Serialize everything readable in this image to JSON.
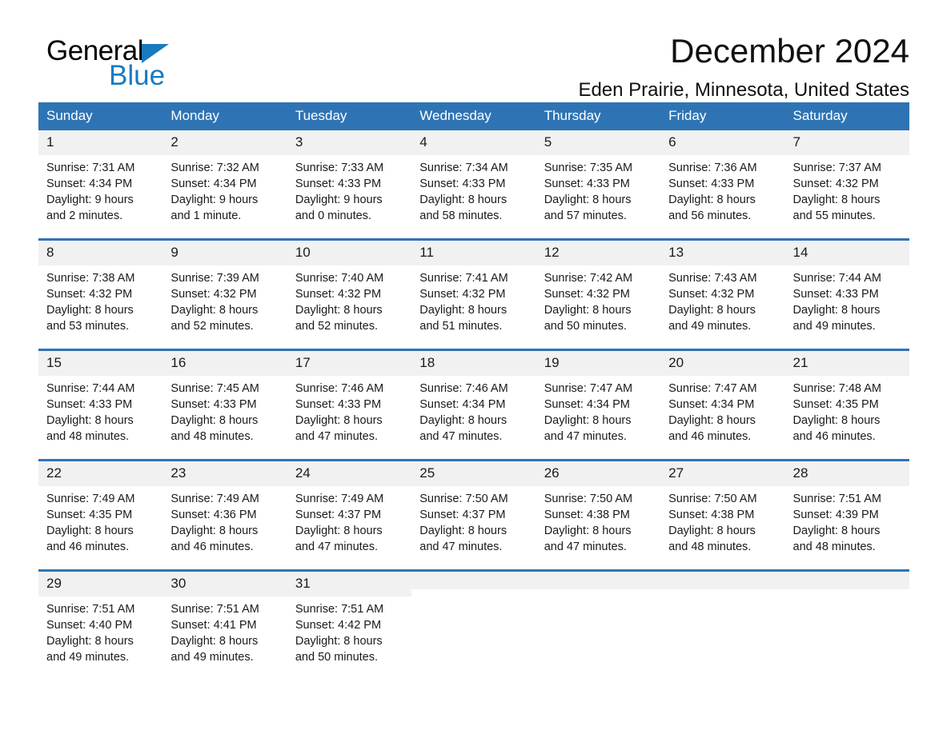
{
  "brand": {
    "name_part1": "General",
    "name_part2": "Blue",
    "accent_color": "#1a7ac0"
  },
  "header": {
    "title": "December 2024",
    "location": "Eden Prairie, Minnesota, United States",
    "header_bg_color": "#2e74b5",
    "daynum_bg_color": "#f1f1f1"
  },
  "weekday_headers": [
    "Sunday",
    "Monday",
    "Tuesday",
    "Wednesday",
    "Thursday",
    "Friday",
    "Saturday"
  ],
  "weeks": [
    [
      {
        "day": "1",
        "sunrise": "Sunrise: 7:31 AM",
        "sunset": "Sunset: 4:34 PM",
        "daylight_line1": "Daylight: 9 hours",
        "daylight_line2": "and 2 minutes."
      },
      {
        "day": "2",
        "sunrise": "Sunrise: 7:32 AM",
        "sunset": "Sunset: 4:34 PM",
        "daylight_line1": "Daylight: 9 hours",
        "daylight_line2": "and 1 minute."
      },
      {
        "day": "3",
        "sunrise": "Sunrise: 7:33 AM",
        "sunset": "Sunset: 4:33 PM",
        "daylight_line1": "Daylight: 9 hours",
        "daylight_line2": "and 0 minutes."
      },
      {
        "day": "4",
        "sunrise": "Sunrise: 7:34 AM",
        "sunset": "Sunset: 4:33 PM",
        "daylight_line1": "Daylight: 8 hours",
        "daylight_line2": "and 58 minutes."
      },
      {
        "day": "5",
        "sunrise": "Sunrise: 7:35 AM",
        "sunset": "Sunset: 4:33 PM",
        "daylight_line1": "Daylight: 8 hours",
        "daylight_line2": "and 57 minutes."
      },
      {
        "day": "6",
        "sunrise": "Sunrise: 7:36 AM",
        "sunset": "Sunset: 4:33 PM",
        "daylight_line1": "Daylight: 8 hours",
        "daylight_line2": "and 56 minutes."
      },
      {
        "day": "7",
        "sunrise": "Sunrise: 7:37 AM",
        "sunset": "Sunset: 4:32 PM",
        "daylight_line1": "Daylight: 8 hours",
        "daylight_line2": "and 55 minutes."
      }
    ],
    [
      {
        "day": "8",
        "sunrise": "Sunrise: 7:38 AM",
        "sunset": "Sunset: 4:32 PM",
        "daylight_line1": "Daylight: 8 hours",
        "daylight_line2": "and 53 minutes."
      },
      {
        "day": "9",
        "sunrise": "Sunrise: 7:39 AM",
        "sunset": "Sunset: 4:32 PM",
        "daylight_line1": "Daylight: 8 hours",
        "daylight_line2": "and 52 minutes."
      },
      {
        "day": "10",
        "sunrise": "Sunrise: 7:40 AM",
        "sunset": "Sunset: 4:32 PM",
        "daylight_line1": "Daylight: 8 hours",
        "daylight_line2": "and 52 minutes."
      },
      {
        "day": "11",
        "sunrise": "Sunrise: 7:41 AM",
        "sunset": "Sunset: 4:32 PM",
        "daylight_line1": "Daylight: 8 hours",
        "daylight_line2": "and 51 minutes."
      },
      {
        "day": "12",
        "sunrise": "Sunrise: 7:42 AM",
        "sunset": "Sunset: 4:32 PM",
        "daylight_line1": "Daylight: 8 hours",
        "daylight_line2": "and 50 minutes."
      },
      {
        "day": "13",
        "sunrise": "Sunrise: 7:43 AM",
        "sunset": "Sunset: 4:32 PM",
        "daylight_line1": "Daylight: 8 hours",
        "daylight_line2": "and 49 minutes."
      },
      {
        "day": "14",
        "sunrise": "Sunrise: 7:44 AM",
        "sunset": "Sunset: 4:33 PM",
        "daylight_line1": "Daylight: 8 hours",
        "daylight_line2": "and 49 minutes."
      }
    ],
    [
      {
        "day": "15",
        "sunrise": "Sunrise: 7:44 AM",
        "sunset": "Sunset: 4:33 PM",
        "daylight_line1": "Daylight: 8 hours",
        "daylight_line2": "and 48 minutes."
      },
      {
        "day": "16",
        "sunrise": "Sunrise: 7:45 AM",
        "sunset": "Sunset: 4:33 PM",
        "daylight_line1": "Daylight: 8 hours",
        "daylight_line2": "and 48 minutes."
      },
      {
        "day": "17",
        "sunrise": "Sunrise: 7:46 AM",
        "sunset": "Sunset: 4:33 PM",
        "daylight_line1": "Daylight: 8 hours",
        "daylight_line2": "and 47 minutes."
      },
      {
        "day": "18",
        "sunrise": "Sunrise: 7:46 AM",
        "sunset": "Sunset: 4:34 PM",
        "daylight_line1": "Daylight: 8 hours",
        "daylight_line2": "and 47 minutes."
      },
      {
        "day": "19",
        "sunrise": "Sunrise: 7:47 AM",
        "sunset": "Sunset: 4:34 PM",
        "daylight_line1": "Daylight: 8 hours",
        "daylight_line2": "and 47 minutes."
      },
      {
        "day": "20",
        "sunrise": "Sunrise: 7:47 AM",
        "sunset": "Sunset: 4:34 PM",
        "daylight_line1": "Daylight: 8 hours",
        "daylight_line2": "and 46 minutes."
      },
      {
        "day": "21",
        "sunrise": "Sunrise: 7:48 AM",
        "sunset": "Sunset: 4:35 PM",
        "daylight_line1": "Daylight: 8 hours",
        "daylight_line2": "and 46 minutes."
      }
    ],
    [
      {
        "day": "22",
        "sunrise": "Sunrise: 7:49 AM",
        "sunset": "Sunset: 4:35 PM",
        "daylight_line1": "Daylight: 8 hours",
        "daylight_line2": "and 46 minutes."
      },
      {
        "day": "23",
        "sunrise": "Sunrise: 7:49 AM",
        "sunset": "Sunset: 4:36 PM",
        "daylight_line1": "Daylight: 8 hours",
        "daylight_line2": "and 46 minutes."
      },
      {
        "day": "24",
        "sunrise": "Sunrise: 7:49 AM",
        "sunset": "Sunset: 4:37 PM",
        "daylight_line1": "Daylight: 8 hours",
        "daylight_line2": "and 47 minutes."
      },
      {
        "day": "25",
        "sunrise": "Sunrise: 7:50 AM",
        "sunset": "Sunset: 4:37 PM",
        "daylight_line1": "Daylight: 8 hours",
        "daylight_line2": "and 47 minutes."
      },
      {
        "day": "26",
        "sunrise": "Sunrise: 7:50 AM",
        "sunset": "Sunset: 4:38 PM",
        "daylight_line1": "Daylight: 8 hours",
        "daylight_line2": "and 47 minutes."
      },
      {
        "day": "27",
        "sunrise": "Sunrise: 7:50 AM",
        "sunset": "Sunset: 4:38 PM",
        "daylight_line1": "Daylight: 8 hours",
        "daylight_line2": "and 48 minutes."
      },
      {
        "day": "28",
        "sunrise": "Sunrise: 7:51 AM",
        "sunset": "Sunset: 4:39 PM",
        "daylight_line1": "Daylight: 8 hours",
        "daylight_line2": "and 48 minutes."
      }
    ],
    [
      {
        "day": "29",
        "sunrise": "Sunrise: 7:51 AM",
        "sunset": "Sunset: 4:40 PM",
        "daylight_line1": "Daylight: 8 hours",
        "daylight_line2": "and 49 minutes."
      },
      {
        "day": "30",
        "sunrise": "Sunrise: 7:51 AM",
        "sunset": "Sunset: 4:41 PM",
        "daylight_line1": "Daylight: 8 hours",
        "daylight_line2": "and 49 minutes."
      },
      {
        "day": "31",
        "sunrise": "Sunrise: 7:51 AM",
        "sunset": "Sunset: 4:42 PM",
        "daylight_line1": "Daylight: 8 hours",
        "daylight_line2": "and 50 minutes."
      },
      {
        "day": "",
        "sunrise": "",
        "sunset": "",
        "daylight_line1": "",
        "daylight_line2": ""
      },
      {
        "day": "",
        "sunrise": "",
        "sunset": "",
        "daylight_line1": "",
        "daylight_line2": ""
      },
      {
        "day": "",
        "sunrise": "",
        "sunset": "",
        "daylight_line1": "",
        "daylight_line2": ""
      },
      {
        "day": "",
        "sunrise": "",
        "sunset": "",
        "daylight_line1": "",
        "daylight_line2": ""
      }
    ]
  ]
}
